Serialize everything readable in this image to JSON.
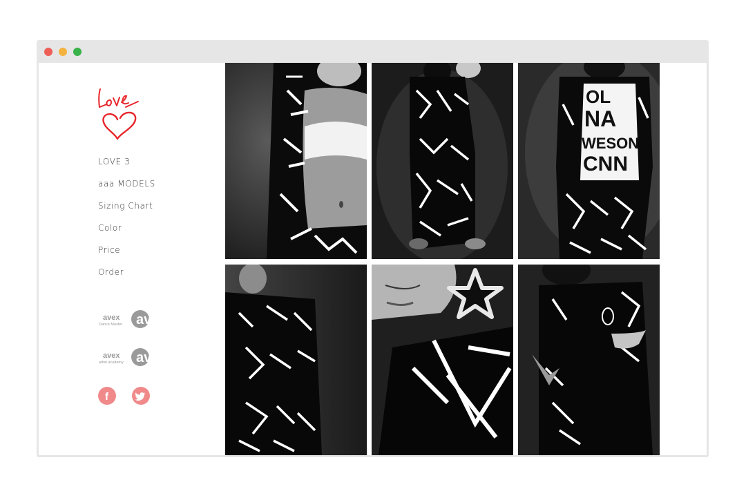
{
  "window": {
    "controls": [
      "close",
      "minimize",
      "maximize"
    ]
  },
  "brand": {
    "logo_text": "Love",
    "logo_icon": "heart-icon",
    "accent_color": "#e8262b"
  },
  "nav": {
    "items": [
      {
        "label": "LOVE 3"
      },
      {
        "label": "aaa MODELS"
      },
      {
        "label": "Sizing Chart"
      },
      {
        "label": "Color"
      },
      {
        "label": "Price"
      },
      {
        "label": "Order"
      }
    ]
  },
  "partners": [
    {
      "name": "avex",
      "sub": "Dance Master"
    },
    {
      "name": "avex",
      "sub": "artist academy"
    }
  ],
  "social": {
    "facebook_glyph": "f",
    "twitter_icon": "twitter-bird-icon",
    "color": "#f08a8a"
  },
  "gallery": {
    "photos": [
      {
        "subject": "model-jacket-crop-top"
      },
      {
        "subject": "two-models-pattern-suits"
      },
      {
        "subject": "model-awesome-text-tee"
      },
      {
        "subject": "model-hooded-jacket-side"
      },
      {
        "subject": "model-star-earring-closeup"
      },
      {
        "subject": "model-hoodie-hand-gesture"
      }
    ],
    "style": "black-and-white"
  }
}
